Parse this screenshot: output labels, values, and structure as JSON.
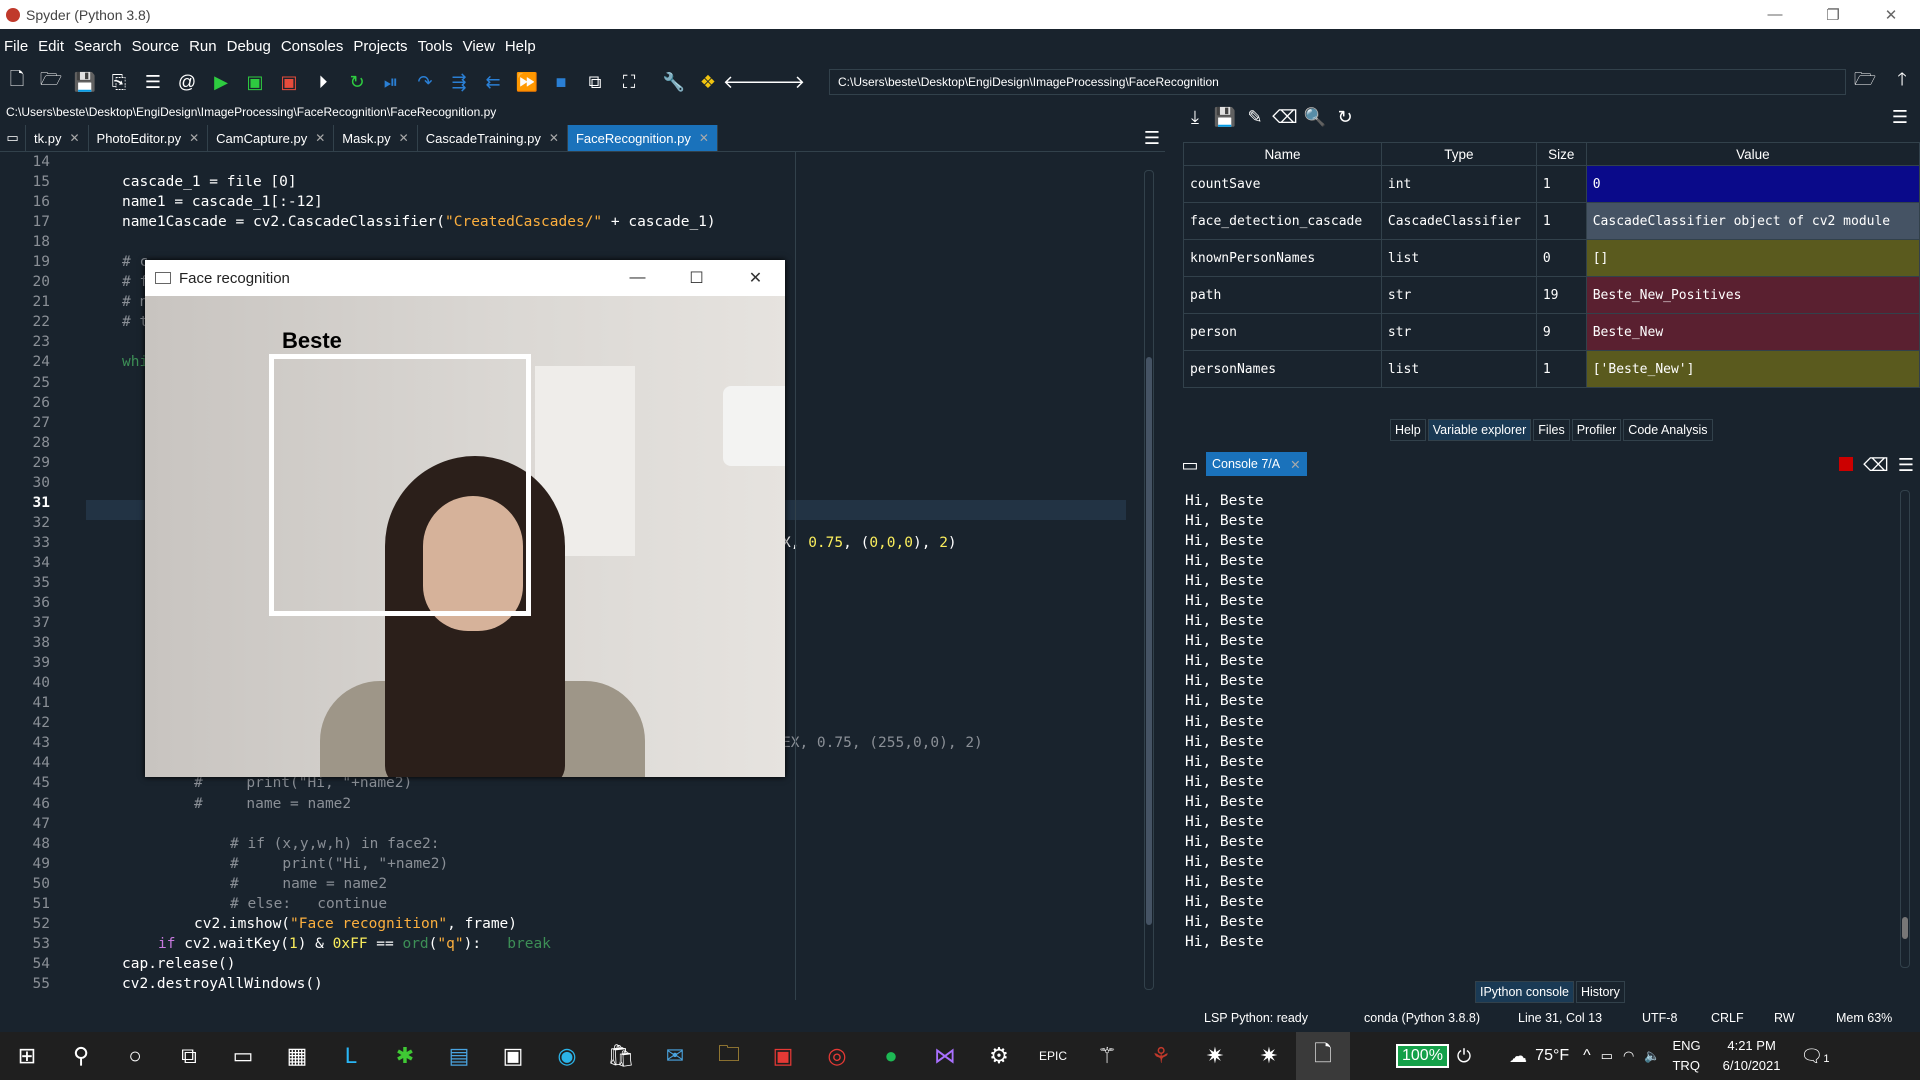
{
  "window": {
    "title": "Spyder (Python 3.8)"
  },
  "menu": [
    "File",
    "Edit",
    "Search",
    "Source",
    "Run",
    "Debug",
    "Consoles",
    "Projects",
    "Tools",
    "View",
    "Help"
  ],
  "toolbar": {
    "path": "C:\\Users\\beste\\Desktop\\EngiDesign\\ImageProcessing\\FaceRecognition"
  },
  "editor": {
    "file_path": "C:\\Users\\beste\\Desktop\\EngiDesign\\ImageProcessing\\FaceRecognition\\FaceRecognition.py",
    "tabs": [
      "tk.py",
      "PhotoEditor.py",
      "CamCapture.py",
      "Mask.py",
      "CascadeTraining.py",
      "FaceRecognition.py"
    ],
    "line_numbers": [
      "14",
      "15",
      "16",
      "17",
      "18",
      "19",
      "20",
      "21",
      "22",
      "23",
      "24",
      "25",
      "26",
      "27",
      "28",
      "29",
      "30",
      "31",
      "32",
      "33",
      "34",
      "35",
      "36",
      "37",
      "38",
      "39",
      "40",
      "41",
      "42",
      "43",
      "44",
      "45",
      "46",
      "47",
      "48",
      "49",
      "50",
      "51",
      "52",
      "53",
      "54",
      "55"
    ],
    "code": {
      "l15": "cascade_1 = file [0]",
      "l16": "name1 = cascade_1[:-12]",
      "l17a": "name1Cascade = cv2.CascadeClassifier(",
      "l17b": "\"CreatedCascades/\"",
      "l17c": " + cascade_1)",
      "l19": "# c",
      "l20": "# f",
      "l21": "# n",
      "l22": "# t",
      "l24": "whi",
      "l33a": "X, ",
      "l33b": "0.75",
      "l33c": ", (",
      "l33d": "0,0,0",
      "l33e": "), ",
      "l33f": "2",
      "l33g": ")",
      "l43": "EX, 0.75, (255,0,0), 2)",
      "l45": "#     print(\"Hi, \"+name2)",
      "l46": "#     name = name2",
      "l48": "# if (x,y,w,h) in face2:",
      "l49": "#     print(\"Hi, \"+name2)",
      "l50": "#     name = name2",
      "l51": "# else:   continue",
      "l52a": "cv2.imshow(",
      "l52b": "\"Face recognition\"",
      "l52c": ", frame)",
      "l53a": "if",
      "l53b": " cv2.waitKey(",
      "l53c": "1",
      "l53d": ") & ",
      "l53e": "0xFF",
      "l53f": " == ",
      "l53g": "ord",
      "l53h": "(",
      "l53i": "\"q\"",
      "l53j": "):   ",
      "l53k": "break",
      "l54": "cap.release()",
      "l55": "cv2.destroyAllWindows()"
    }
  },
  "face_window": {
    "title": "Face recognition",
    "label": "Beste"
  },
  "variable_explorer": {
    "headers": [
      "Name",
      "Type",
      "Size",
      "Value"
    ],
    "rows": [
      {
        "name": "countSave",
        "type": "int",
        "size": "1",
        "value": "0",
        "color": "#0a0a8a"
      },
      {
        "name": "face_detection_cascade",
        "type": "CascadeClassifier",
        "size": "1",
        "value": "CascadeClassifier object of cv2 module",
        "color": "#455364"
      },
      {
        "name": "knownPersonNames",
        "type": "list",
        "size": "0",
        "value": "[]",
        "color": "#5a5a1e"
      },
      {
        "name": "path",
        "type": "str",
        "size": "19",
        "value": "Beste_New_Positives",
        "color": "#5a2030"
      },
      {
        "name": "person",
        "type": "str",
        "size": "9",
        "value": "Beste_New",
        "color": "#5a2030"
      },
      {
        "name": "personNames",
        "type": "list",
        "size": "1",
        "value": "['Beste_New']",
        "color": "#5a5a1e"
      }
    ],
    "pane_tabs": [
      "Help",
      "Variable explorer",
      "Files",
      "Profiler",
      "Code Analysis"
    ]
  },
  "console": {
    "tab": "Console 7/A",
    "lines": [
      "Hi, Beste",
      "Hi, Beste",
      "Hi, Beste",
      "Hi, Beste",
      "Hi, Beste",
      "Hi, Beste",
      "Hi, Beste",
      "Hi, Beste",
      "Hi, Beste",
      "Hi, Beste",
      "Hi, Beste",
      "Hi, Beste",
      "Hi, Beste",
      "Hi, Beste",
      "Hi, Beste",
      "Hi, Beste",
      "Hi, Beste",
      "Hi, Beste",
      "Hi, Beste",
      "Hi, Beste",
      "Hi, Beste",
      "Hi, Beste",
      "Hi, Beste"
    ],
    "bottom_tabs": [
      "IPython console",
      "History"
    ]
  },
  "status": {
    "lsp": "LSP Python: ready",
    "conda": "conda (Python 3.8.8)",
    "position": "Line 31, Col 13",
    "encoding": "UTF-8",
    "eol": "CRLF",
    "rw": "RW",
    "mem": "Mem 63%"
  },
  "taskbar": {
    "battery": "100%",
    "temp": "75°F",
    "lang1": "ENG",
    "lang2": "TRQ",
    "time": "4:21 PM",
    "date": "6/10/2021",
    "notif_count": "1"
  }
}
